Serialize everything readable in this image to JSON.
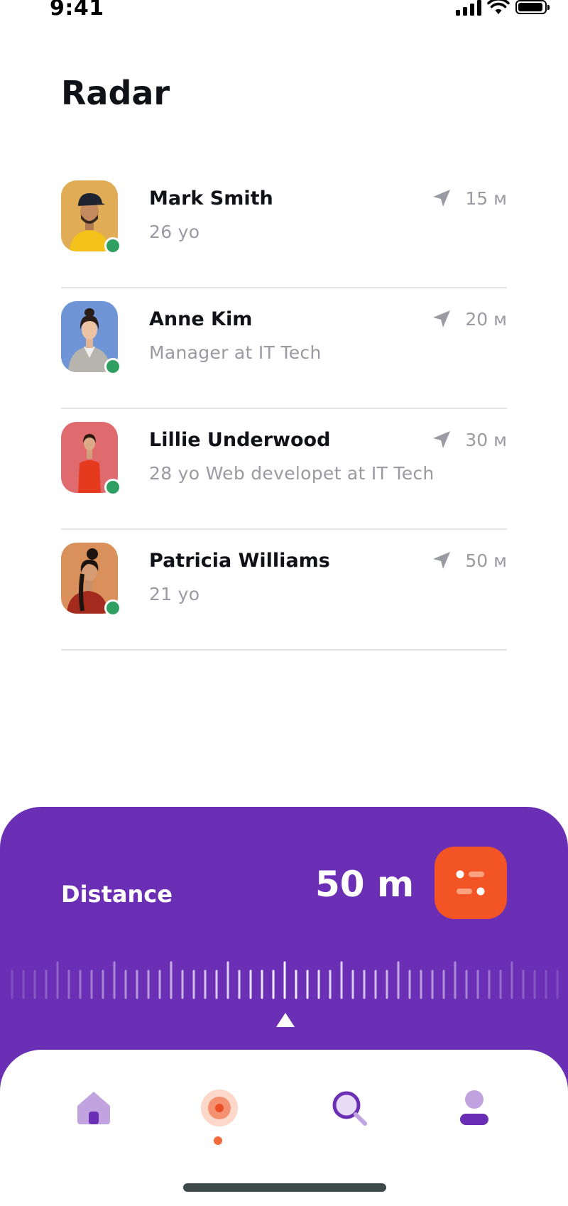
{
  "status_bar": {
    "time": "9:41",
    "battery_level": 1.0
  },
  "header": {
    "title": "Radar"
  },
  "people": [
    {
      "name": "Mark Smith",
      "description": "26 yo",
      "distance": "15 м",
      "online": true,
      "avatar_bg": "#e0ac55"
    },
    {
      "name": "Anne Kim",
      "description": "Manager at IT Tech",
      "distance": "20 м",
      "online": true,
      "avatar_bg": "#6f95d6"
    },
    {
      "name": "Lillie Underwood",
      "description": "28 yo  Web developet at IT Tech",
      "distance": "30 м",
      "online": true,
      "avatar_bg": "#e06b6f"
    },
    {
      "name": "Patricia Williams",
      "description": "21 yo",
      "distance": "50 м",
      "online": true,
      "avatar_bg": "#d9905a"
    }
  ],
  "distance_panel": {
    "label": "Distance",
    "value": "50 m"
  },
  "bottom_nav": {
    "items": [
      "home-icon",
      "radar-icon",
      "search-icon",
      "profile-icon"
    ],
    "active": "radar-icon"
  },
  "colors": {
    "panel": "#6a2fb4",
    "accent": "#f35425",
    "online": "#2fa062",
    "nav_lavender": "#c1a3e0"
  }
}
